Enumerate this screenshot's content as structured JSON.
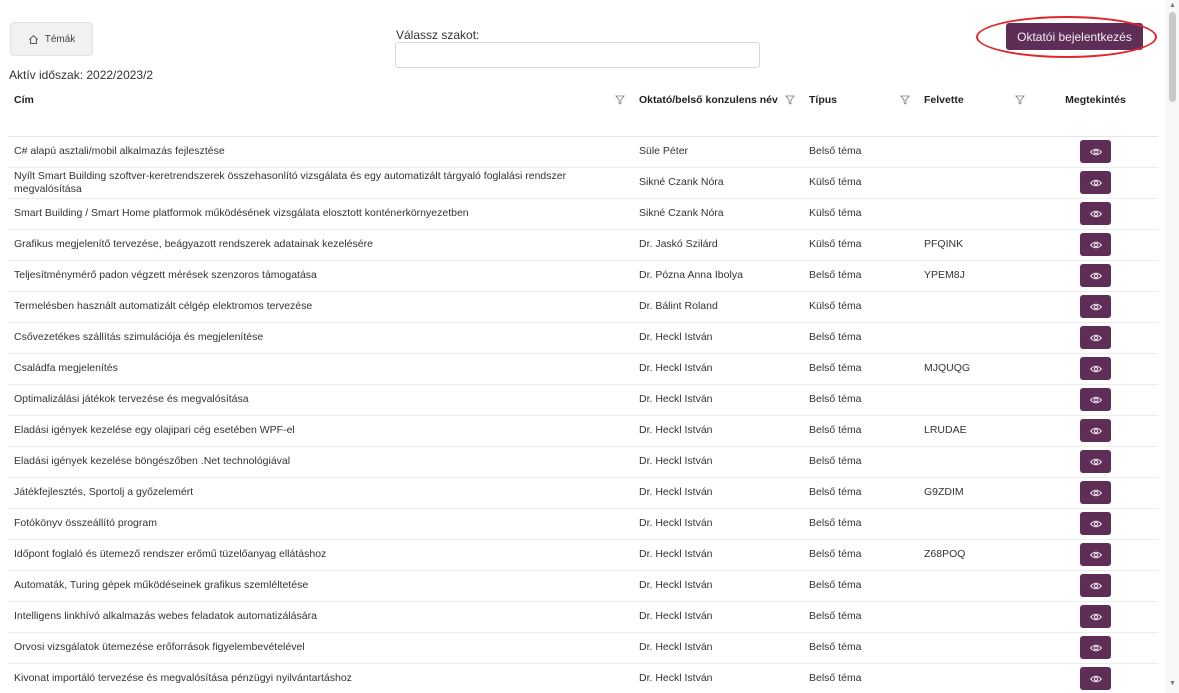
{
  "header": {
    "home_label": "Témák",
    "major_label": "Válassz szakot:",
    "major_value": "",
    "login_label": "Oktatói bejelentkezés",
    "period_label": "Aktív időszak: 2022/2023/2"
  },
  "table": {
    "columns": [
      "Cím",
      "Oktató/belső konzulens név",
      "Típus",
      "Felvette",
      "Megtekintés"
    ],
    "rows": [
      {
        "title": "C# alapú asztali/mobil alkalmazás fejlesztése",
        "advisor": "Süle Péter",
        "type": "Belső téma",
        "taken": ""
      },
      {
        "title": "Nyílt Smart Building szoftver-keretrendszerek összehasonlító vizsgálata és egy automatizált tárgyaló foglalási rendszer megvalósítása",
        "advisor": "Sikné Czank Nóra",
        "type": "Külső téma",
        "taken": ""
      },
      {
        "title": "Smart Building / Smart Home platformok működésének vizsgálata elosztott konténerkörnyezetben",
        "advisor": "Sikné Czank Nóra",
        "type": "Külső téma",
        "taken": ""
      },
      {
        "title": "Grafikus megjelenítő tervezése, beágyazott rendszerek adatainak kezelésére",
        "advisor": "Dr. Jaskó Szilárd",
        "type": "Külső téma",
        "taken": "PFQINK"
      },
      {
        "title": "Teljesítménymérő padon végzett mérések szenzoros támogatása",
        "advisor": "Dr. Pózna Anna Ibolya",
        "type": "Belső téma",
        "taken": "YPEM8J"
      },
      {
        "title": "Termelésben használt automatizált célgép elektromos tervezése",
        "advisor": "Dr. Bálint Roland",
        "type": "Külső téma",
        "taken": ""
      },
      {
        "title": "Csővezetékes szállítás szimulációja és megjelenítése",
        "advisor": "Dr. Heckl István",
        "type": "Belső téma",
        "taken": ""
      },
      {
        "title": "Családfa megjelenítés",
        "advisor": "Dr. Heckl István",
        "type": "Belső téma",
        "taken": "MJQUQG"
      },
      {
        "title": "Optimalizálási játékok tervezése és megvalósítása",
        "advisor": "Dr. Heckl István",
        "type": "Belső téma",
        "taken": ""
      },
      {
        "title": "Eladási igények kezelése egy olajipari cég esetében WPF-el",
        "advisor": "Dr. Heckl István",
        "type": "Belső téma",
        "taken": "LRUDAE"
      },
      {
        "title": "Eladási igények kezelése böngészőben .Net technológiával",
        "advisor": "Dr. Heckl István",
        "type": "Belső téma",
        "taken": ""
      },
      {
        "title": "Játékfejlesztés, Sportolj a győzelemért",
        "advisor": "Dr. Heckl István",
        "type": "Belső téma",
        "taken": "G9ZDIM"
      },
      {
        "title": "Fotókönyv összeállító program",
        "advisor": "Dr. Heckl István",
        "type": "Belső téma",
        "taken": ""
      },
      {
        "title": "Időpont foglaló és ütemező rendszer erőmű tüzelőanyag ellátáshoz",
        "advisor": "Dr. Heckl István",
        "type": "Belső téma",
        "taken": "Z68POQ"
      },
      {
        "title": "Automaták, Turing gépek működéseinek grafikus szemléltetése",
        "advisor": "Dr. Heckl István",
        "type": "Belső téma",
        "taken": ""
      },
      {
        "title": "Intelligens linkhívó alkalmazás webes feladatok automatizálására",
        "advisor": "Dr. Heckl István",
        "type": "Belső téma",
        "taken": ""
      },
      {
        "title": "Orvosi vizsgálatok ütemezése erőforrások figyelembevételével",
        "advisor": "Dr. Heckl István",
        "type": "Belső téma",
        "taken": ""
      },
      {
        "title": "Kivonat importáló tervezése és megvalósítása pénzügyi nyilvántartáshoz",
        "advisor": "Dr. Heckl István",
        "type": "Belső téma",
        "taken": ""
      }
    ]
  },
  "colors": {
    "accent": "#5e2e56",
    "highlight_ring": "#e0262b"
  }
}
